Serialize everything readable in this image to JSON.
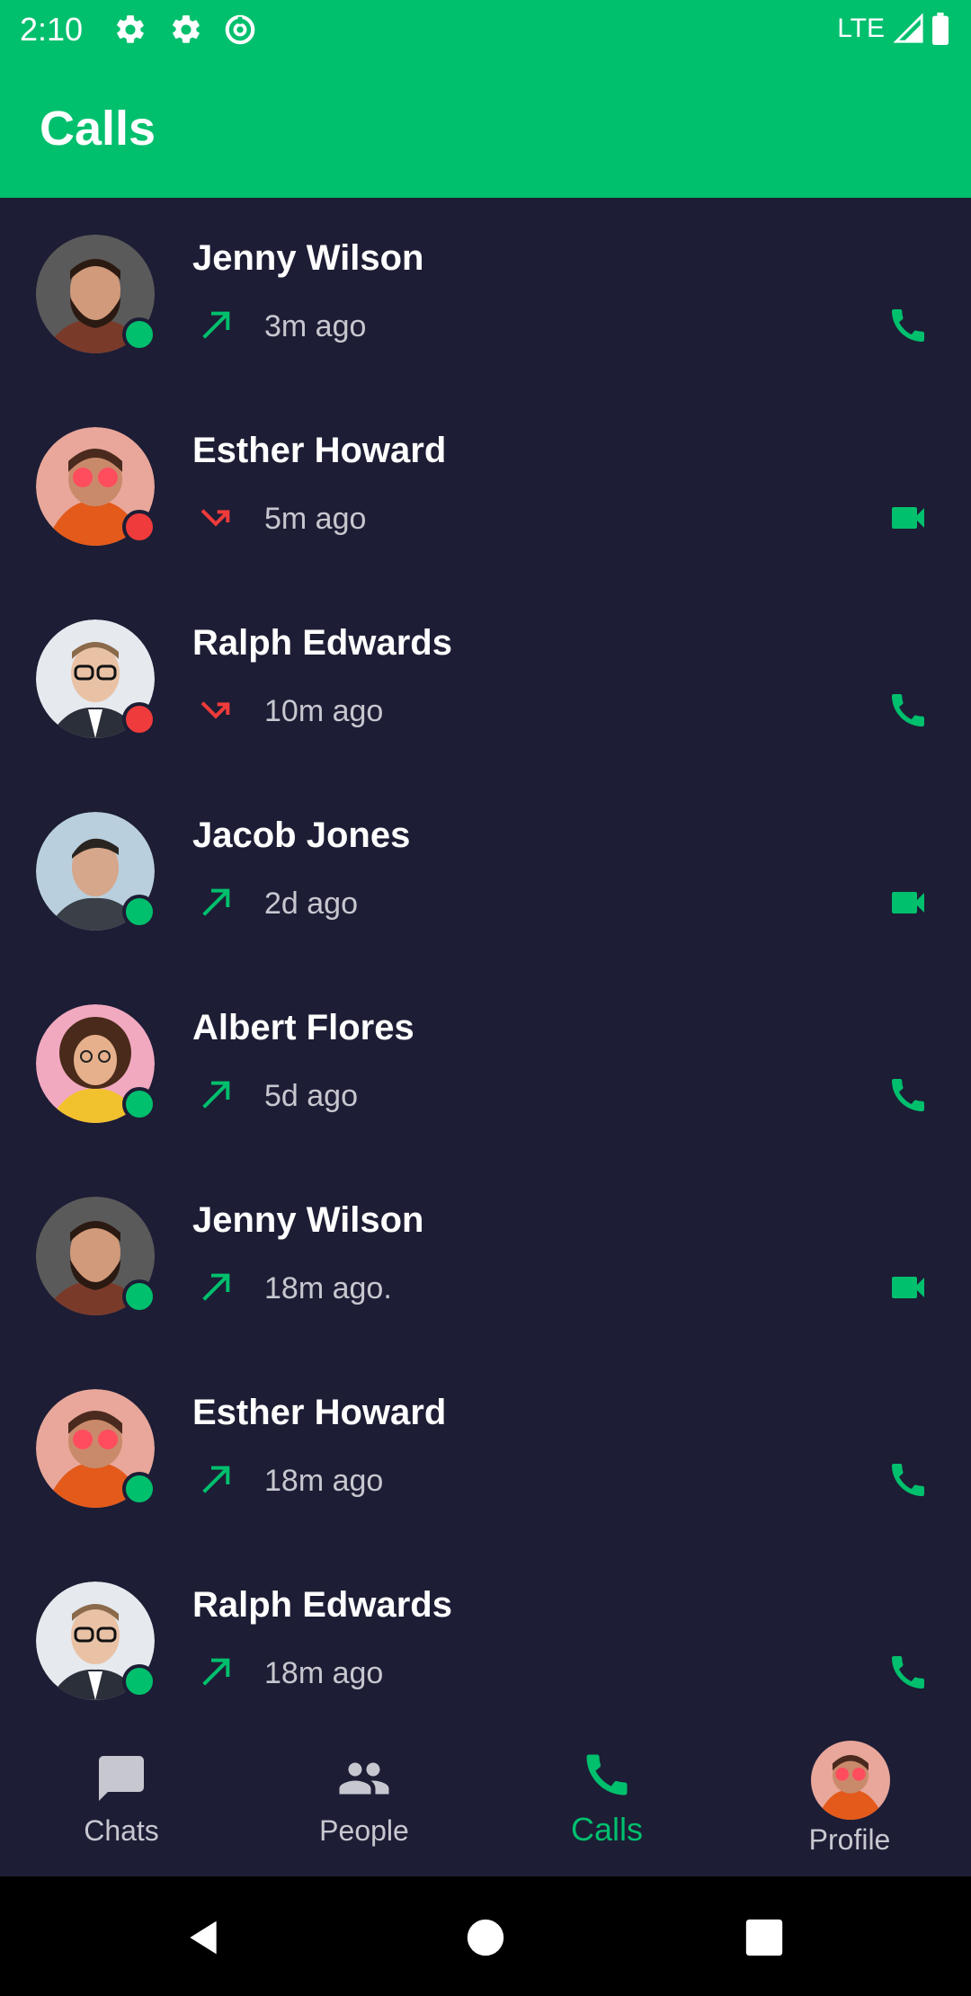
{
  "status_bar": {
    "time": "2:10",
    "network": "LTE"
  },
  "app_bar": {
    "title": "Calls"
  },
  "colors": {
    "accent": "#00BF6D",
    "background": "#1D1D35",
    "missed": "#EF3B3B",
    "online": "#00BF6D"
  },
  "calls": [
    {
      "name": "Jenny Wilson",
      "time": "3m ago",
      "direction": "outgoing",
      "type": "voice",
      "status": "online",
      "avatar": "bearded-man"
    },
    {
      "name": "Esther Howard",
      "time": "5m ago",
      "direction": "missed",
      "type": "video",
      "status": "offline",
      "avatar": "orange-hoodie"
    },
    {
      "name": "Ralph Edwards",
      "time": "10m ago",
      "direction": "missed",
      "type": "voice",
      "status": "offline",
      "avatar": "glasses-man"
    },
    {
      "name": "Jacob Jones",
      "time": "2d ago",
      "direction": "outgoing",
      "type": "video",
      "status": "online",
      "avatar": "young-man"
    },
    {
      "name": "Albert Flores",
      "time": "5d ago",
      "direction": "outgoing",
      "type": "voice",
      "status": "online",
      "avatar": "curly-woman"
    },
    {
      "name": "Jenny Wilson",
      "time": "18m ago.",
      "direction": "outgoing",
      "type": "video",
      "status": "online",
      "avatar": "bearded-man"
    },
    {
      "name": "Esther Howard",
      "time": "18m ago",
      "direction": "outgoing",
      "type": "voice",
      "status": "online",
      "avatar": "orange-hoodie"
    },
    {
      "name": "Ralph Edwards",
      "time": "18m ago",
      "direction": "outgoing",
      "type": "voice",
      "status": "online",
      "avatar": "glasses-man"
    }
  ],
  "bottom_nav": [
    {
      "label": "Chats",
      "icon": "chat-icon",
      "active": false
    },
    {
      "label": "People",
      "icon": "people-icon",
      "active": false
    },
    {
      "label": "Calls",
      "icon": "phone-icon",
      "active": true
    },
    {
      "label": "Profile",
      "icon": "profile-avatar",
      "active": false
    }
  ]
}
